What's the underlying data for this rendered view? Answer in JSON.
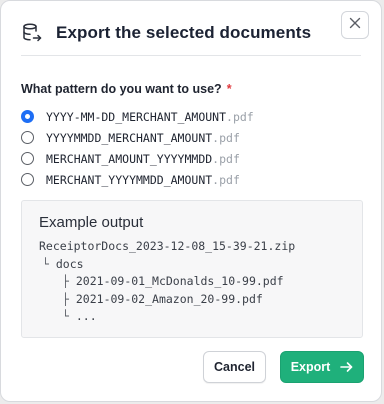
{
  "dialog": {
    "title": "Export the selected documents",
    "close_icon": "close-icon",
    "header_icon": "database-export-icon"
  },
  "form": {
    "question": "What pattern do you want to use?",
    "required_marker": "*",
    "options": [
      {
        "pattern": "YYYY-MM-DD_MERCHANT_AMOUNT",
        "ext": ".pdf",
        "checked": true
      },
      {
        "pattern": "YYYYMMDD_MERCHANT_AMOUNT",
        "ext": ".pdf",
        "checked": false
      },
      {
        "pattern": "MERCHANT_AMOUNT_YYYYMMDD",
        "ext": ".pdf",
        "checked": false
      },
      {
        "pattern": "MERCHANT_YYYYMMDD_AMOUNT",
        "ext": ".pdf",
        "checked": false
      }
    ]
  },
  "example": {
    "title": "Example output",
    "zip": "ReceiptorDocs_2023-12-08_15-39-21.zip",
    "folder_prefix": "└",
    "folder": "docs",
    "file_prefix_1": "├",
    "file_1": "2021-09-01_McDonalds_10-99.pdf",
    "file_prefix_2": "├",
    "file_2": "2021-09-02_Amazon_20-99.pdf",
    "more_prefix": "└",
    "more": "..."
  },
  "footer": {
    "cancel_label": "Cancel",
    "export_label": "Export",
    "export_icon": "arrow-right-icon"
  },
  "colors": {
    "accent_green": "#1fb07b",
    "radio_blue": "#1e6ef5",
    "required_red": "#e0393e"
  }
}
